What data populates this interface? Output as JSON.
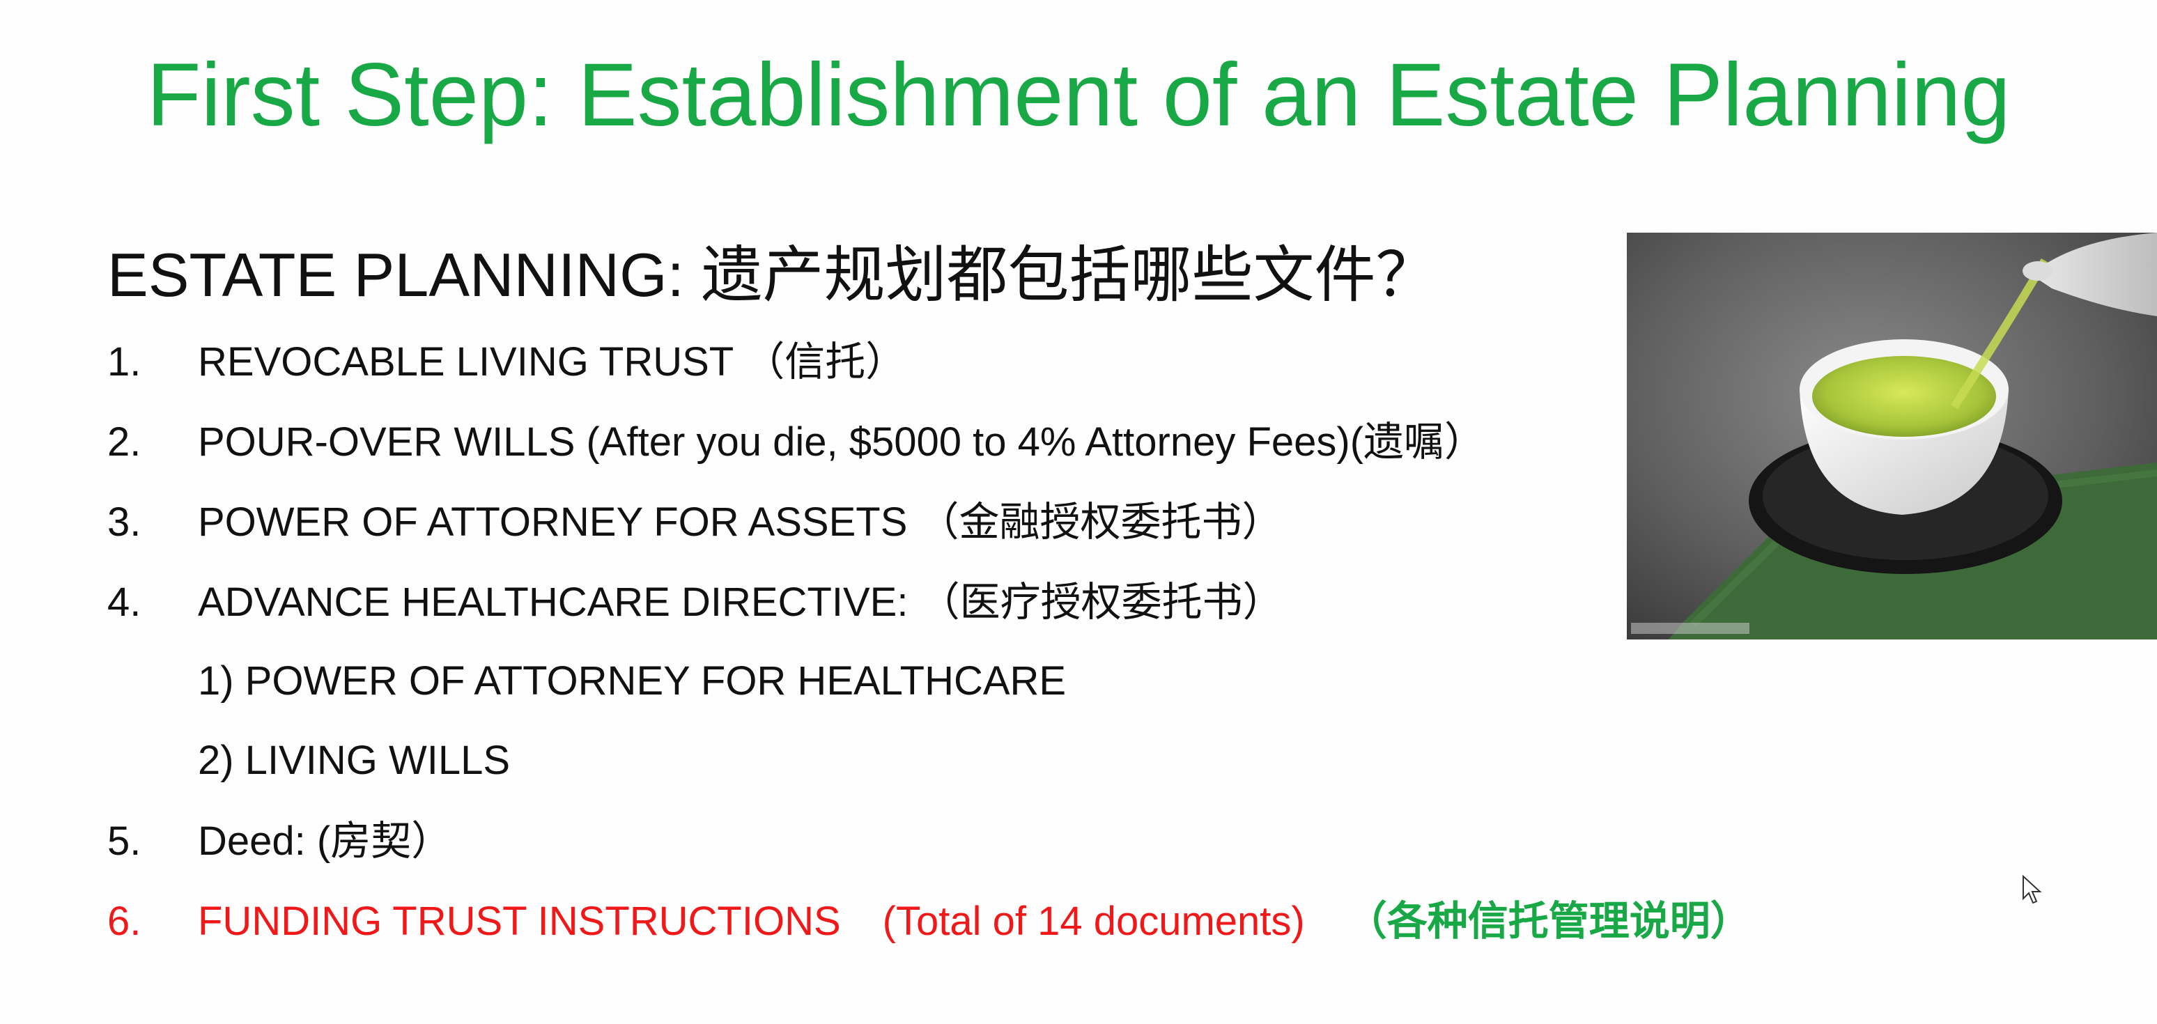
{
  "slide": {
    "title": "First Step: Establishment of an Estate Planning",
    "subtitle": "ESTATE PLANNING:  遗产规划都包括哪些文件？",
    "items": [
      {
        "num": "1.",
        "text": "REVOCABLE LIVING TRUST （信托）"
      },
      {
        "num": "2.",
        "text": "POUR-OVER WILLS (After you die, $5000 to 4% Attorney Fees)(遗嘱）"
      },
      {
        "num": "3.",
        "text": "POWER OF ATTORNEY FOR ASSETS （金融授权委托书）"
      },
      {
        "num": "4.",
        "text": "ADVANCE HEALTHCARE DIRECTIVE: （医疗授权委托书）"
      },
      {
        "num": "",
        "text": "1) POWER OF ATTORNEY FOR HEALTHCARE"
      },
      {
        "num": "",
        "text": "2) LIVING WILLS"
      },
      {
        "num": "5.",
        "text": "Deed: (房契）"
      }
    ],
    "item6": {
      "num": "6.",
      "text_red": "FUNDING TRUST INSTRUCTIONS",
      "text_red2": "(Total of 14 documents)",
      "text_green": "（各种信托管理说明）"
    },
    "colors": {
      "title": "#19a846",
      "highlight_red": "#f01818",
      "highlight_green": "#19a846",
      "text": "#111111",
      "background": "#fefefe"
    },
    "image": {
      "subject": "green tea being poured into white cup on saucer"
    },
    "icons": {
      "cursor": "mouse-pointer-icon"
    }
  }
}
